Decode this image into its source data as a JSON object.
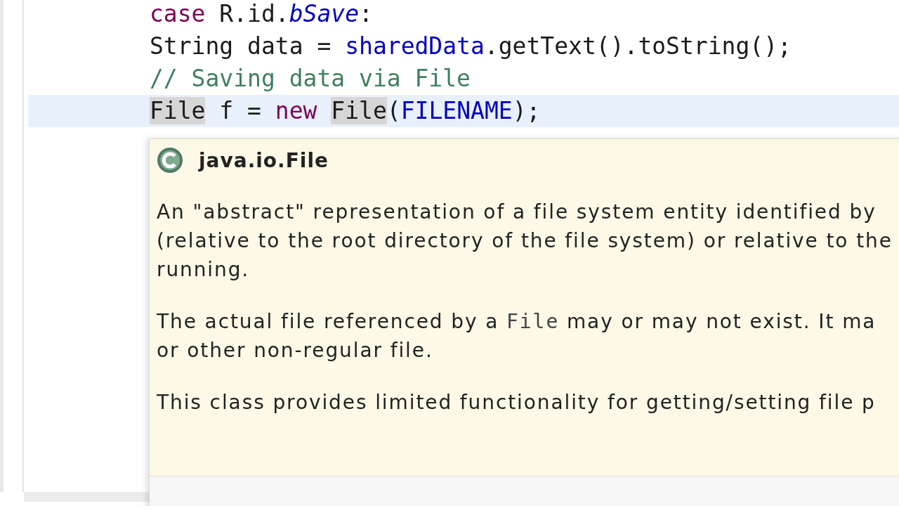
{
  "editor": {
    "lines": [
      {
        "current": false,
        "tokens": [
          {
            "text": "case",
            "kind": "keyword",
            "marked": false
          },
          {
            "text": " R.id.",
            "kind": "plain",
            "marked": false
          },
          {
            "text": "bSave",
            "kind": "constant",
            "marked": false
          },
          {
            "text": ":",
            "kind": "plain",
            "marked": false
          }
        ]
      },
      {
        "current": false,
        "tokens": [
          {
            "text": "String data = ",
            "kind": "plain",
            "marked": false
          },
          {
            "text": "sharedData",
            "kind": "field",
            "marked": false
          },
          {
            "text": ".getText().toString();",
            "kind": "plain",
            "marked": false
          }
        ]
      },
      {
        "current": false,
        "tokens": [
          {
            "text": "// Saving data via File",
            "kind": "comment",
            "marked": false
          }
        ]
      },
      {
        "current": true,
        "tokens": [
          {
            "text": "File",
            "kind": "plain",
            "marked": true
          },
          {
            "text": " f = ",
            "kind": "plain",
            "marked": false
          },
          {
            "text": "new ",
            "kind": "keyword",
            "marked": false
          },
          {
            "text": "File",
            "kind": "plain",
            "marked": true
          },
          {
            "text": "(",
            "kind": "plain",
            "marked": false
          },
          {
            "text": "FILENAME",
            "kind": "field",
            "marked": false
          },
          {
            "text": ");",
            "kind": "plain",
            "marked": false
          }
        ]
      }
    ]
  },
  "hover": {
    "title": "java.io.File",
    "paragraphs": [
      [
        [
          {
            "text": "An \"abstract\" representation of a file system entity identified by",
            "code": false
          }
        ],
        [
          {
            "text": "(relative to the root directory of the file system) or relative to the",
            "code": false
          }
        ],
        [
          {
            "text": "running.",
            "code": false
          }
        ]
      ],
      [
        [
          {
            "text": "The actual file referenced by a ",
            "code": false
          },
          {
            "text": "File",
            "code": true
          },
          {
            "text": " may or may not exist. It ma",
            "code": false
          }
        ],
        [
          {
            "text": "or other non-regular file.",
            "code": false
          }
        ]
      ],
      [
        [
          {
            "text": "This class provides limited functionality for getting/setting file p",
            "code": false
          }
        ]
      ]
    ]
  }
}
